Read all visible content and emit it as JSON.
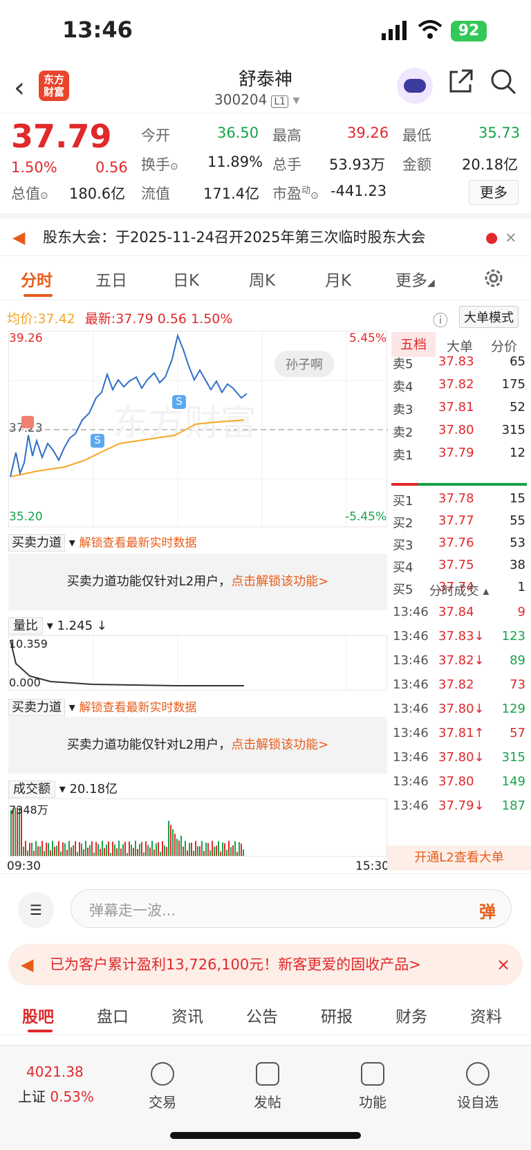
{
  "status": {
    "time": "13:46",
    "battery": "92"
  },
  "header": {
    "logo": "东方财富",
    "title": "舒泰神",
    "code": "300204",
    "level": "L1"
  },
  "quote": {
    "price": "37.79",
    "pct": "1.50%",
    "change": "0.56",
    "open_label": "今开",
    "open": "36.50",
    "high_label": "最高",
    "high": "39.26",
    "low_label": "最低",
    "low": "35.73",
    "turnover_label": "换手",
    "turnover": "11.89%",
    "volume_label": "总手",
    "volume": "53.93万",
    "amount_label": "金额",
    "amount": "20.18亿",
    "mcap_label": "总值",
    "mcap": "180.6亿",
    "float_label": "流值",
    "float": "171.4亿",
    "pe_label": "市盈",
    "pe_sup": "动",
    "pe": "-441.23",
    "more": "更多"
  },
  "notice": {
    "text": "股东大会：于2025-11-24召开2025年第三次临时股东大会"
  },
  "tabs": [
    "分时",
    "五日",
    "日K",
    "周K",
    "月K",
    "更多"
  ],
  "avg": {
    "avg_label": "均价:",
    "avg": "37.42",
    "last_label": "最新:",
    "last": "37.79",
    "chg": "0.56",
    "pct": "1.50%",
    "bigorder": "大单模式"
  },
  "chart": {
    "top": "39.26",
    "bottom": "35.20",
    "top_pct": "5.45%",
    "bottom_pct": "-5.45%",
    "mid": "37.23",
    "watermark": "东方财富",
    "user": "孙子啊",
    "start": "09:30",
    "end": "15:30"
  },
  "indicators": {
    "ind1": "买卖力道",
    "unlock": "解锁查看最新实时数据",
    "lock_text": "买卖力道功能仅针对L2用户，",
    "lock_link": "点击解锁该功能>",
    "ratio": "量比",
    "ratio_val": "1.245 ↓",
    "ratio_top": "10.359",
    "ratio_bottom": "0.000",
    "amount": "成交额",
    "amount_val": "20.18亿",
    "amount_top": "7348万"
  },
  "orderbook": {
    "tabs": [
      "五档",
      "大单",
      "分价"
    ],
    "asks": [
      {
        "l": "卖5",
        "p": "37.83",
        "v": "65"
      },
      {
        "l": "卖4",
        "p": "37.82",
        "v": "175"
      },
      {
        "l": "卖3",
        "p": "37.81",
        "v": "52"
      },
      {
        "l": "卖2",
        "p": "37.80",
        "v": "315"
      },
      {
        "l": "卖1",
        "p": "37.79",
        "v": "12"
      }
    ],
    "bids": [
      {
        "l": "买1",
        "p": "37.78",
        "v": "15"
      },
      {
        "l": "买2",
        "p": "37.77",
        "v": "55"
      },
      {
        "l": "买3",
        "p": "37.76",
        "v": "53"
      },
      {
        "l": "买4",
        "p": "37.75",
        "v": "38"
      },
      {
        "l": "买5",
        "p": "37.74",
        "v": "1"
      }
    ],
    "trades_title": "分时成交",
    "trades": [
      {
        "t": "13:46",
        "p": "37.84",
        "v": "9"
      },
      {
        "t": "13:46",
        "p": "37.83↓",
        "v": "123"
      },
      {
        "t": "13:46",
        "p": "37.82↓",
        "v": "89"
      },
      {
        "t": "13:46",
        "p": "37.82",
        "v": "73"
      },
      {
        "t": "13:46",
        "p": "37.80↓",
        "v": "129"
      },
      {
        "t": "13:46",
        "p": "37.81↑",
        "v": "57"
      },
      {
        "t": "13:46",
        "p": "37.80↓",
        "v": "315"
      },
      {
        "t": "13:46",
        "p": "37.80",
        "v": "149"
      },
      {
        "t": "13:46",
        "p": "37.79↓",
        "v": "187"
      }
    ],
    "l2": "开通L2查看大单"
  },
  "comment": {
    "placeholder": "弹幕走一波...",
    "btn": "弹"
  },
  "promo": {
    "text": "已为客户累计盈利13,726,100元！新客更爱的固收产品>"
  },
  "btabs": [
    "股吧",
    "盘口",
    "资讯",
    "公告",
    "研报",
    "财务",
    "资料"
  ],
  "bottom": {
    "index": "4021.38",
    "index_name": "上证",
    "index_pct": "0.53%",
    "trade": "交易",
    "post": "发帖",
    "func": "功能",
    "watch": "设自选"
  }
}
